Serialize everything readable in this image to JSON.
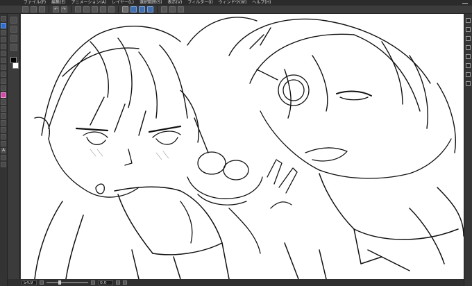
{
  "menubar": {
    "items": [
      "ファイル(F)",
      "編集(E)",
      "アニメーション(A)",
      "レイヤー(L)",
      "選択範囲(S)",
      "表示(V)",
      "フィルター(I)",
      "ウィンドウ(W)",
      "ヘルプ(H)"
    ]
  },
  "statusbar": {
    "zoom": "54.9",
    "angle": "0.0",
    "zoom_fraction": 0.3
  },
  "colors": {
    "main_color": "#000000",
    "sub_color": "#ffffff",
    "accent": "#2e6ecf",
    "highlight_tool": "#d04aa6"
  },
  "icons": {
    "cmdbar": [
      "new-file-icon",
      "open-icon",
      "save-icon",
      "undo-icon",
      "redo-icon",
      "clear-icon",
      "transform-icon",
      "select-all-icon",
      "deselect-icon",
      "invert-icon",
      "ruler-icon",
      "pen-icon",
      "brush-icon",
      "snap-icon",
      "grid-icon",
      "view-icon",
      "rotate-icon"
    ]
  }
}
